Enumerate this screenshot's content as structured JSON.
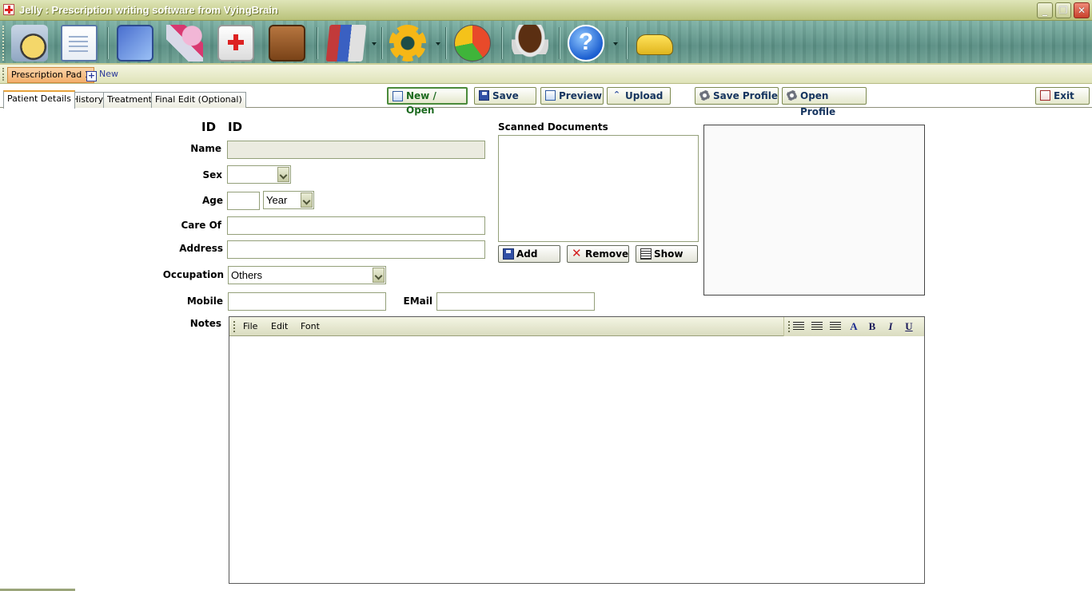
{
  "window": {
    "title": "Jelly : Prescription writing software from VyingBrain"
  },
  "toolbar": {
    "icons": [
      "calendar-clock-icon",
      "prescription-pad-icon",
      "photo-gallery-icon",
      "medicine-pills-icon",
      "first-aid-kit-icon",
      "doctor-bag-icon",
      "books-icon",
      "settings-gear-icon",
      "pie-chart-icon",
      "coffee-cup-icon",
      "help-icon",
      "taxi-icon"
    ]
  },
  "doc_tabs": {
    "active": "Prescription Pad 1",
    "new_label": "New"
  },
  "page_tabs": [
    "Patient Details",
    "History",
    "Treatment",
    "Final Edit (Optional)"
  ],
  "actions": {
    "new_open": "New / Open",
    "save": "Save",
    "preview": "Preview",
    "upload": "Upload",
    "save_profile": "Save Profile",
    "open_profile": "Open Profile",
    "exit": "Exit"
  },
  "form": {
    "id_label": "ID",
    "id_value": "ID",
    "name_label": "Name",
    "name_value": "",
    "sex_label": "Sex",
    "sex_value": "",
    "age_label": "Age",
    "age_value": "",
    "age_unit": "Year",
    "care_of_label": "Care Of",
    "address_label": "Address",
    "occupation_label": "Occupation",
    "occupation_value": "Others",
    "mobile_label": "Mobile",
    "email_label": "EMail",
    "notes_label": "Notes"
  },
  "scanned": {
    "label": "Scanned Documents",
    "add": "Add",
    "remove": "Remove",
    "show": "Show"
  },
  "editor": {
    "menus": [
      "File",
      "Edit",
      "Font"
    ],
    "format_buttons": [
      "A",
      "B",
      "I",
      "U"
    ]
  }
}
